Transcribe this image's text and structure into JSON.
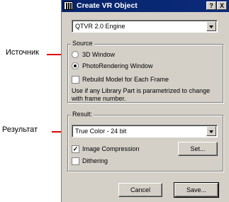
{
  "annotations": {
    "source": "Источник",
    "result": "Результат",
    "arrow_color": "#e00000"
  },
  "window": {
    "title": "Create VR Object",
    "help_button": "?",
    "close_button": "X"
  },
  "engine": {
    "selected": "QTVR 2.0 Engine"
  },
  "source": {
    "label": "Source",
    "options": [
      {
        "label": "3D Window",
        "selected": false
      },
      {
        "label": "PhotoRendering Window",
        "selected": true
      }
    ],
    "rebuild": {
      "label": "Rebuild Model for Each Frame",
      "checked": false
    },
    "note_line1": "Use if any Library Part is parametrized to change",
    "note_line2": "with frame number."
  },
  "result": {
    "label": "Result:",
    "format": "True Color - 24 bit",
    "image_compression": {
      "label": "Image Compression",
      "checked": true
    },
    "set_button": "Set...",
    "dithering": {
      "label": "Dithering",
      "checked": false
    }
  },
  "buttons": {
    "cancel": "Cancel",
    "save": "Save..."
  },
  "colors": {
    "title_bar": "#08246b",
    "dialog_face": "#d4d0c8"
  }
}
